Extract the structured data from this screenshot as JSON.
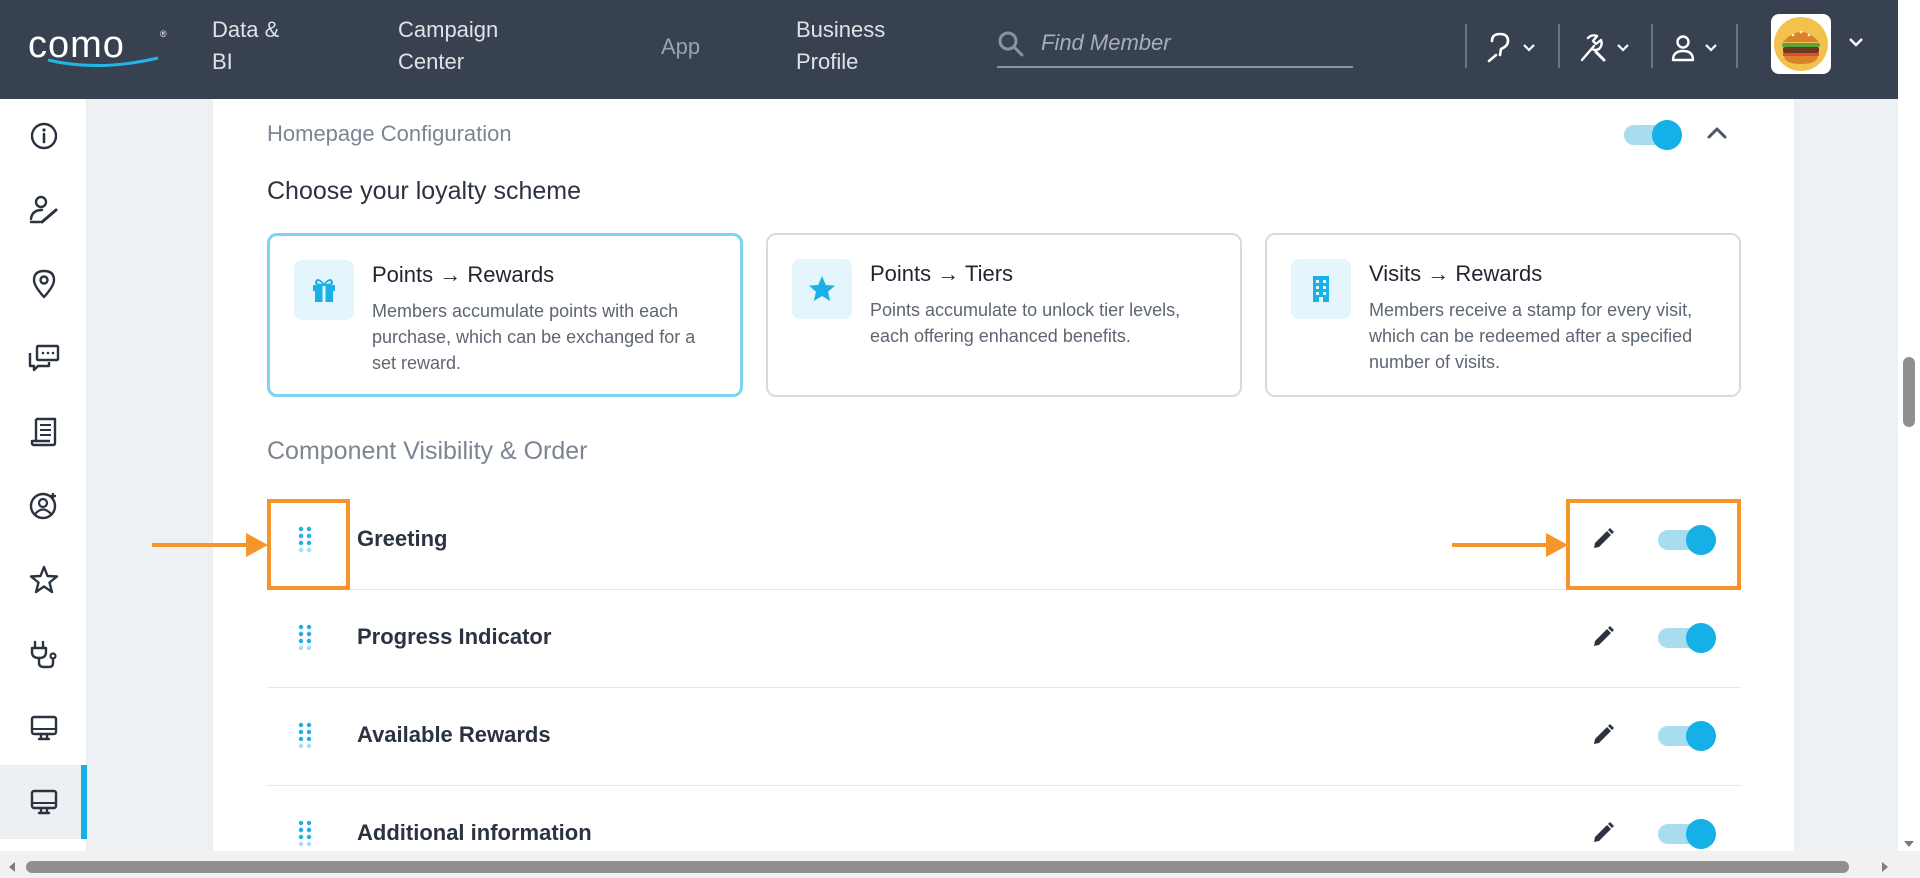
{
  "topbar": {
    "logo_text": "como",
    "logo_mark": "®",
    "nav": [
      {
        "line1": "Data &",
        "line2": "BI"
      },
      {
        "line1": "Campaign",
        "line2": "Center"
      },
      {
        "line1": "App",
        "line2": ""
      },
      {
        "line1": "Business",
        "line2": "Profile"
      }
    ],
    "search_placeholder": "Find Member",
    "icons": [
      "help-icon",
      "tools-icon",
      "user-icon"
    ],
    "avatar_icon": "burger-logo-icon"
  },
  "sidebar": {
    "items": [
      {
        "icon": "info-icon"
      },
      {
        "icon": "member-edit-icon"
      },
      {
        "icon": "location-pin-icon"
      },
      {
        "icon": "chat-bubbles-icon"
      },
      {
        "icon": "receipt-icon"
      },
      {
        "icon": "user-add-icon"
      },
      {
        "icon": "star-icon"
      },
      {
        "icon": "plug-icon"
      },
      {
        "icon": "monitor-icon"
      },
      {
        "icon": "monitor-active-icon",
        "active": true
      }
    ]
  },
  "main": {
    "section_title": "Homepage Configuration",
    "homepage_enabled": true,
    "loyalty_title": "Choose your loyalty scheme",
    "schemes": [
      {
        "title": "Points → Rewards",
        "desc": "Members accumulate points with each purchase, which can be exchanged for a set reward.",
        "icon": "gift-icon",
        "selected": true
      },
      {
        "title": "Points → Tiers",
        "desc": "Points accumulate to unlock tier levels, each offering enhanced benefits.",
        "icon": "star-icon",
        "selected": false
      },
      {
        "title": "Visits → Rewards",
        "desc": "Members receive a stamp for every visit, which can be redeemed after a specified number of visits.",
        "icon": "building-icon",
        "selected": false
      }
    ],
    "components_title": "Component Visibility & Order",
    "components": [
      {
        "label": "Greeting",
        "enabled": true
      },
      {
        "label": "Progress Indicator",
        "enabled": true
      },
      {
        "label": "Available Rewards",
        "enabled": true
      },
      {
        "label": "Additional information",
        "enabled": true
      }
    ]
  },
  "colors": {
    "topbar": "#38414f",
    "accent": "#14b0e6",
    "highlight": "#f7952d",
    "selected_border": "#7fd3f0"
  }
}
